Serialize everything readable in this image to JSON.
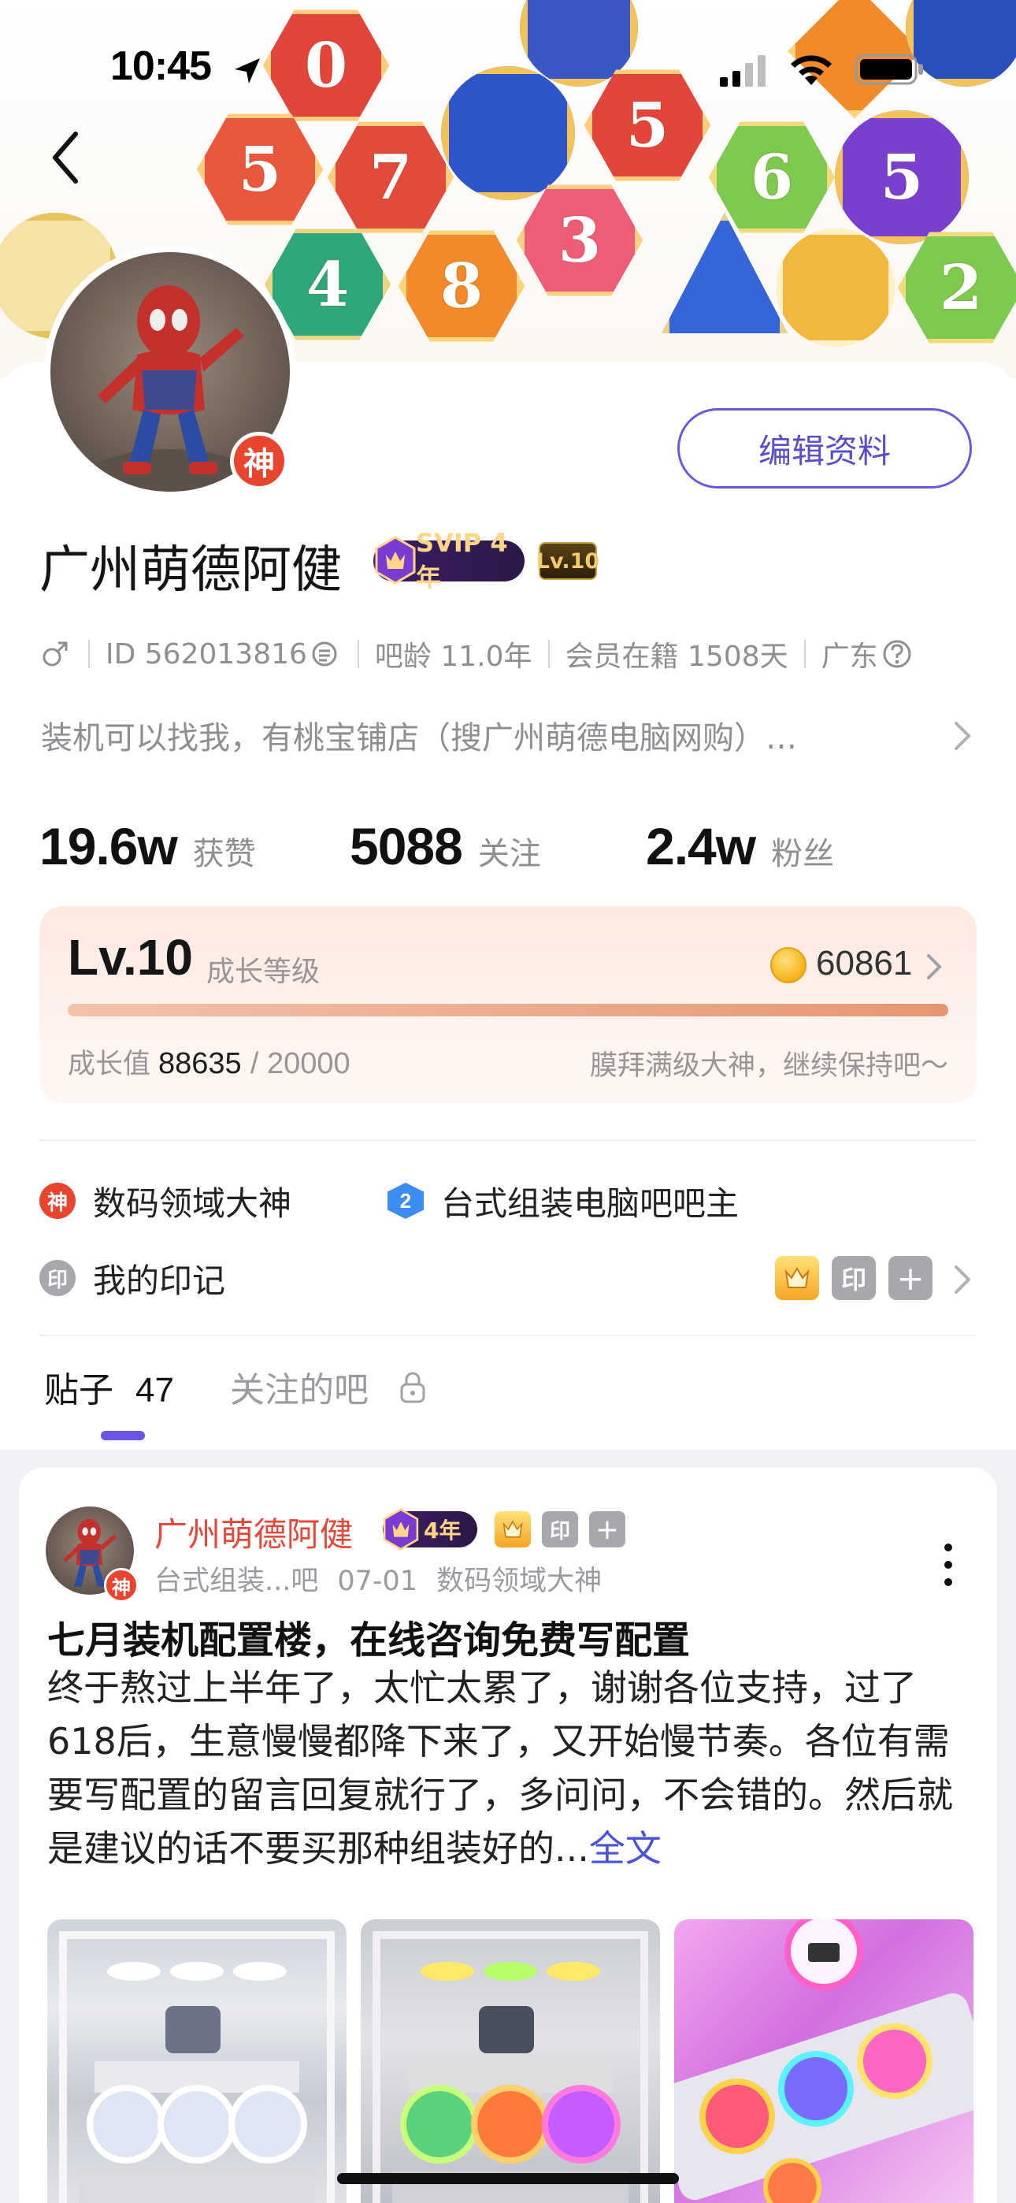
{
  "status_bar": {
    "time": "10:45"
  },
  "banner": {
    "badges": [
      "0",
      "5",
      "7",
      "5",
      "6",
      "5",
      "3",
      "4",
      "8",
      "2"
    ]
  },
  "profile": {
    "avatar_badge": "神",
    "edit_button": "编辑资料",
    "name": "广州萌德阿健",
    "svip_tag": "SVIP 4年",
    "level_tag": "Lv.10",
    "meta": {
      "id": "ID 562013816",
      "bar_age": "吧龄 11.0年",
      "member_days": "会员在籍 1508天",
      "region": "广东"
    },
    "bio": "装机可以找我，有桃宝铺店（搜广州萌德电脑网购）…"
  },
  "stats": [
    {
      "num": "19.6w",
      "label": "获赞"
    },
    {
      "num": "5088",
      "label": "关注"
    },
    {
      "num": "2.4w",
      "label": "粉丝"
    }
  ],
  "level_card": {
    "level": "Lv.10",
    "level_label": "成长等级",
    "coins": "60861",
    "progress": 1.0,
    "growth_label": "成长值",
    "growth_value": "88635",
    "growth_max": "/ 20000",
    "message": "膜拜满级大神，继续保持吧～"
  },
  "honors": [
    {
      "icon": "神",
      "label": "数码领域大神",
      "color": "#e8452f"
    },
    {
      "icon": "2",
      "label": "台式组装电脑吧吧主",
      "color": "#3d8cf0"
    }
  ],
  "seal": {
    "icon": "印",
    "label": "我的印记",
    "stamp": "印",
    "add": "+"
  },
  "tabs": {
    "posts_label": "贴子",
    "posts_count": "47",
    "followed_bars": "关注的吧"
  },
  "post": {
    "author": "广州萌德阿健",
    "avatar_badge": "神",
    "vip_tag": "4年",
    "badge_stamp": "印",
    "badge_add": "+",
    "bar": "台式组装...吧",
    "date": "07-01",
    "honor": "数码领域大神",
    "title": "七月装机配置楼，在线咨询免费写配置",
    "body": "终于熬过上半年了，太忙太累了，谢谢各位支持，过了618后，生意慢慢都降下来了，又开始慢节奏。各位有需要写配置的留言回复就行了，多问问，不会错的。然后就是建议的话不要买那种组装好的",
    "ellipsis": "...",
    "full_text": "全文"
  },
  "colors": {
    "accent": "#6b56e3",
    "author_red": "#e5483a",
    "link_blue": "#4a52d8"
  }
}
